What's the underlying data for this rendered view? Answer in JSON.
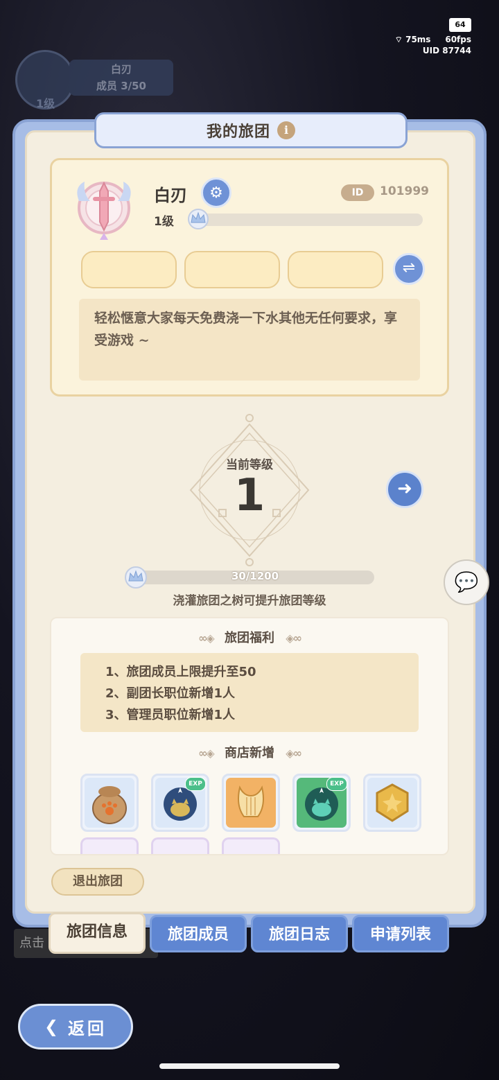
{
  "status": {
    "battery": "64",
    "ping": "75ms",
    "fps": "60fps",
    "uid": "UID 87744"
  },
  "background_badge": {
    "name": "白刃",
    "members": "成员  3/50",
    "level": "1级"
  },
  "dialog": {
    "title": "我的旅团",
    "info_icon": "i"
  },
  "guild": {
    "name": "白刃",
    "id_label": "ID",
    "id_value": "101999",
    "level_label": "1级",
    "level_progress": 0,
    "description": "轻松惬意大家每天免费浇一下水其他无任何要求，享受游戏 ~"
  },
  "level_section": {
    "label": "当前等级",
    "value": "1",
    "xp_text": "30/1200",
    "xp_current": 30,
    "xp_max": 1200,
    "hint": "浇灌旅团之树可提升旅团等级"
  },
  "benefits": {
    "title": "旅团福利",
    "items": [
      "1、旅团成员上限提升至50",
      "2、副团长职位新增1人",
      "3、管理员职位新增1人"
    ]
  },
  "shop": {
    "title": "商店新增",
    "items": [
      {
        "icon": "paw-bag-icon",
        "exp": false
      },
      {
        "icon": "exp-blue-cat-icon",
        "exp": true
      },
      {
        "icon": "lyre-icon",
        "exp": false
      },
      {
        "icon": "exp-green-cat-icon",
        "exp": true
      },
      {
        "icon": "gold-coin-icon",
        "exp": false
      }
    ],
    "exp_label": "EXP"
  },
  "leave_button": "退出旅团",
  "tabs": [
    {
      "label": "旅团信息",
      "active": true
    },
    {
      "label": "旅团成员",
      "active": false
    },
    {
      "label": "旅团日志",
      "active": false
    },
    {
      "label": "申请列表",
      "active": false
    }
  ],
  "bg_hint": "点击",
  "back_button": "返回",
  "colors": {
    "accent_blue": "#6f92d6",
    "panel_cream": "#f4eee0",
    "frame_blue": "#a7bde6"
  }
}
